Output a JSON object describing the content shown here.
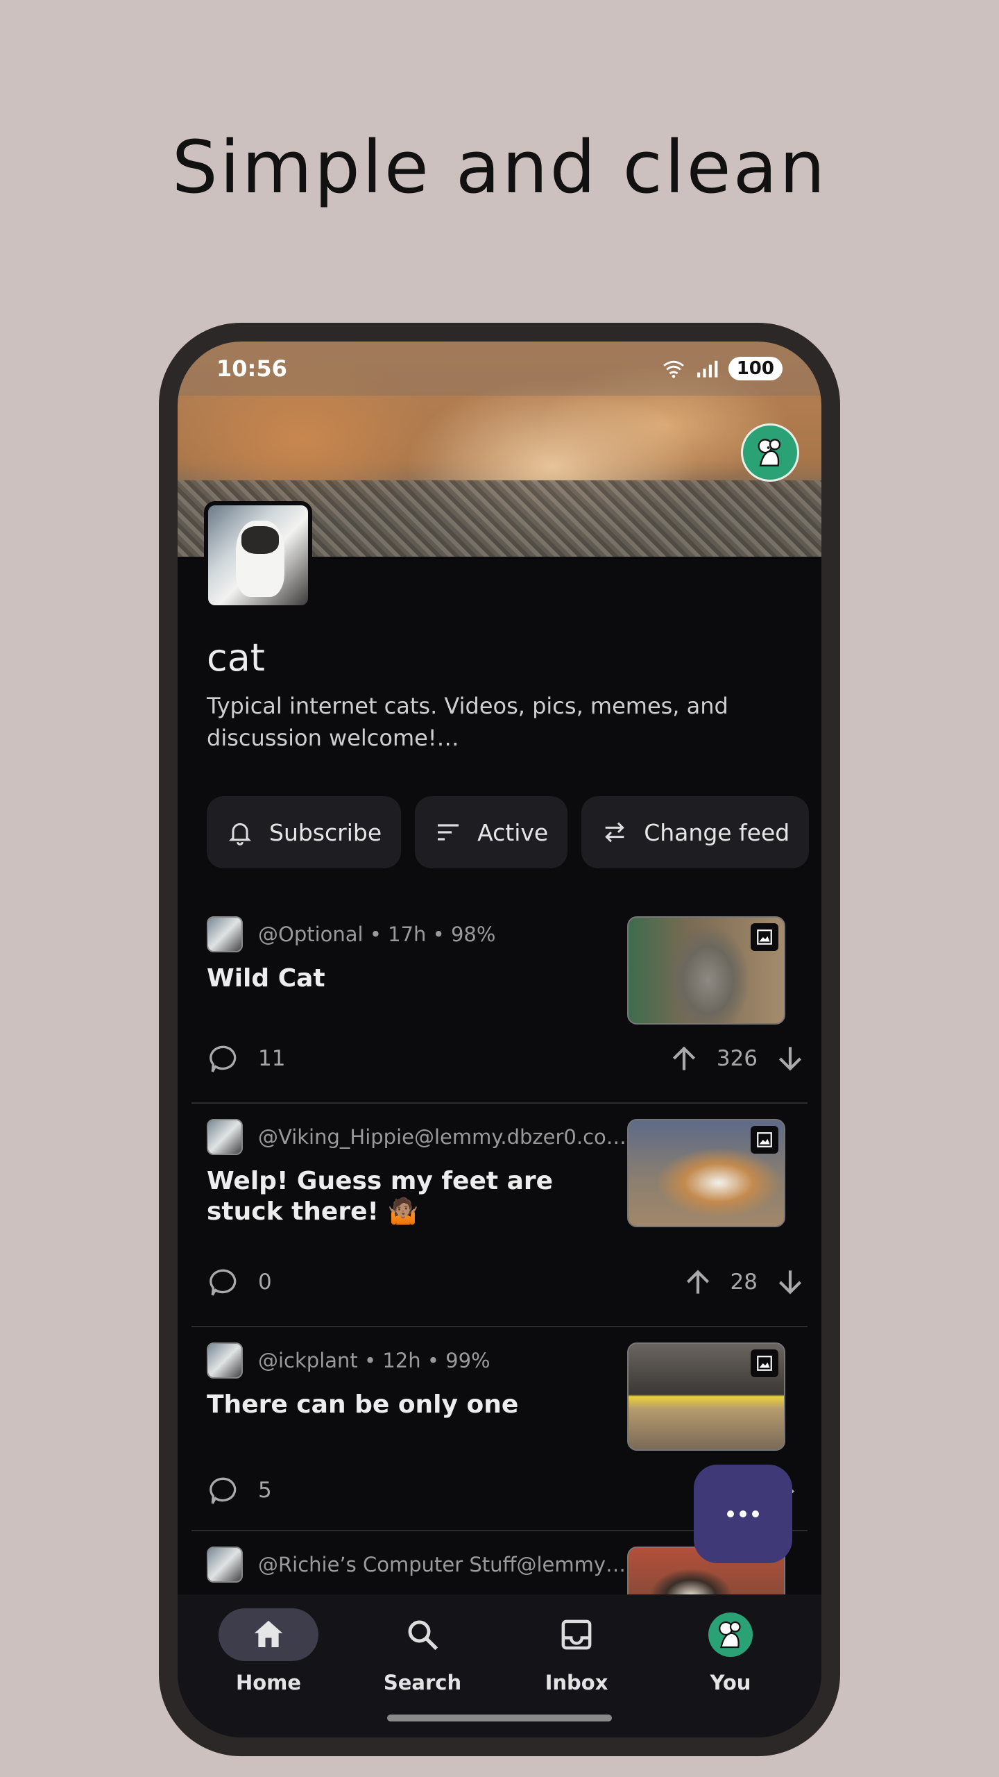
{
  "headline": "Simple and clean",
  "status_bar": {
    "time": "10:56",
    "battery": "100"
  },
  "community": {
    "name": "cat",
    "description": "Typical internet cats. Videos, pics, memes, and discussion welcome!…"
  },
  "chips": [
    {
      "label": "Subscribe",
      "icon": "bell-icon"
    },
    {
      "label": "Active",
      "icon": "sort-icon"
    },
    {
      "label": "Change feed",
      "icon": "swap-arrows-icon"
    }
  ],
  "posts": [
    {
      "meta": "@Optional • 17h • 98%",
      "title": "Wild Cat",
      "comments": "11",
      "score": "326"
    },
    {
      "meta": "@Viking_Hippie@lemmy.dbzer0.co…",
      "title": "Welp! Guess my feet are stuck there! 🤷🏽",
      "comments": "0",
      "score": "28"
    },
    {
      "meta": "@ickplant • 12h • 99%",
      "title": "There can be only one",
      "comments": "5",
      "score": ""
    },
    {
      "meta": "@Richie’s Computer Stuff@lemmy…",
      "title": "",
      "comments": "",
      "score": ""
    }
  ],
  "nav": [
    {
      "label": "Home",
      "icon": "home-icon",
      "active": true
    },
    {
      "label": "Search",
      "icon": "search-icon"
    },
    {
      "label": "Inbox",
      "icon": "inbox-icon"
    },
    {
      "label": "You",
      "icon": "user-avatar-icon"
    }
  ],
  "colors": {
    "background": "#cdc1c0",
    "screen": "#0b0b0d",
    "chip": "#1e1e22",
    "fab": "#3f3a77",
    "avatar_green": "#2aa275"
  }
}
